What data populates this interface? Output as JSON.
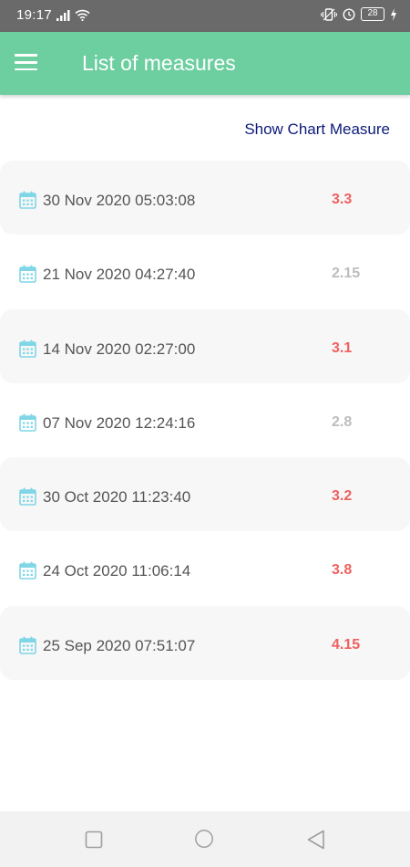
{
  "status_bar": {
    "time": "19:17",
    "battery": "28",
    "icons": [
      "signal-icon",
      "wifi-icon",
      "vibrate-icon",
      "alarm-icon",
      "battery-icon",
      "charging-icon"
    ]
  },
  "app_bar": {
    "title": "List of measures",
    "menu_icon": "hamburger-menu-icon",
    "background_color": "#6dcea0"
  },
  "actions": {
    "show_chart_label": "Show Chart Measure"
  },
  "measures": [
    {
      "date": "30 Nov 2020 05:03:08",
      "value": "3.3",
      "status": "red"
    },
    {
      "date": "21 Nov 2020 04:27:40",
      "value": "2.15",
      "status": "grey"
    },
    {
      "date": "14 Nov 2020 02:27:00",
      "value": "3.1",
      "status": "red"
    },
    {
      "date": "07 Nov 2020 12:24:16",
      "value": "2.8",
      "status": "grey"
    },
    {
      "date": "30 Oct 2020 11:23:40",
      "value": "3.2",
      "status": "red"
    },
    {
      "date": "24 Oct 2020 11:06:14",
      "value": "3.8",
      "status": "red"
    },
    {
      "date": "25 Sep 2020 07:51:07",
      "value": "4.15",
      "status": "red"
    }
  ],
  "colors": {
    "value_high": "#f06060",
    "value_normal": "#bdbdbd",
    "calendar_icon": "#7fd6e6",
    "link": "#0d1a7a"
  },
  "nav_bar": {
    "icons": [
      "recents-square-icon",
      "home-circle-icon",
      "back-triangle-icon"
    ]
  }
}
